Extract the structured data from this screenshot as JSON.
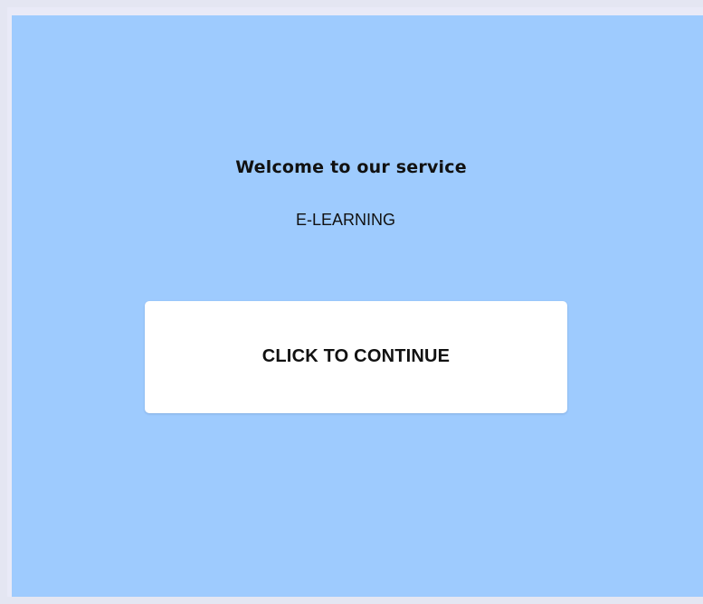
{
  "colors": {
    "page_background": "#e4e6f2",
    "panel_background": "#9ecbfe",
    "button_background": "#ffffff",
    "text": "#111111"
  },
  "main": {
    "welcome_text": "Welcome to our service",
    "subtitle": "E-LEARNING",
    "continue_button_label": "CLICK TO CONTINUE"
  }
}
